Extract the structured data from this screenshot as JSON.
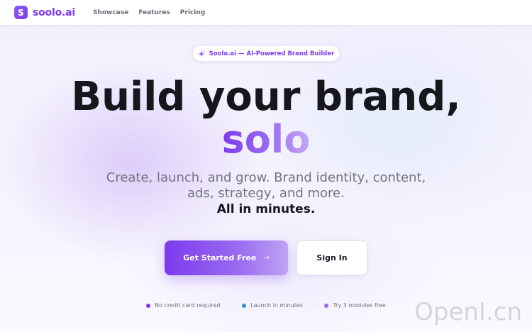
{
  "nav": {
    "logo_letter": "S",
    "logo_text": "soolo.ai",
    "links": [
      "Showcase",
      "Features",
      "Pricing"
    ]
  },
  "badge": {
    "icon": "sparkle-icon",
    "text": "Soolo.ai — AI-Powered Brand Builder"
  },
  "hero": {
    "headline": "Build your brand,",
    "headline_accent": "solo",
    "subtitle_line1": "Create, launch, and grow. Brand identity, content,",
    "subtitle_line2": "ads, strategy, and more.",
    "subtitle_strong": "All in minutes."
  },
  "actions": {
    "primary_label": "Get Started Free",
    "primary_icon": "arrow-right-icon",
    "primary_arrow": "→",
    "secondary_label": "Sign In"
  },
  "features": [
    {
      "text": "No credit card required",
      "dot_color": "#7c3aed"
    },
    {
      "text": "Launch in minutes",
      "dot_color": "#3b8fd6"
    },
    {
      "text": "Try 3 modules free",
      "dot_color": "#9b6cf2"
    }
  ],
  "separator": "·",
  "watermark": "OpenI.cn",
  "colors": {
    "brand": "#7c3aed",
    "headline": "#16161d",
    "muted": "#74747f"
  }
}
